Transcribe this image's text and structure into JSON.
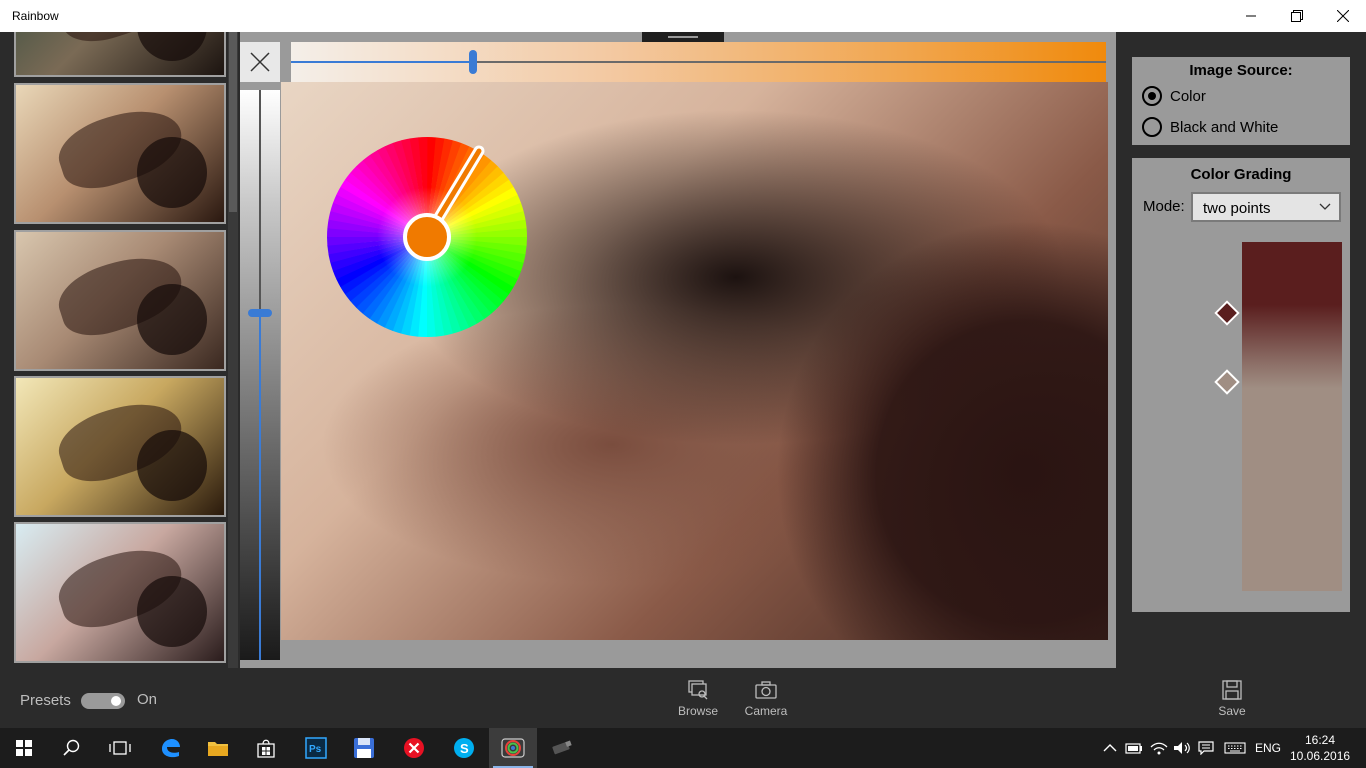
{
  "window": {
    "title": "Rainbow"
  },
  "presets": {
    "thumbnails": [
      {
        "tint": "linear-gradient(135deg,#2f4a3c,#7a6a55 50%,#1c1410)"
      },
      {
        "tint": "linear-gradient(135deg,#e9d7b8,#b89070 45%,#2a1810)"
      },
      {
        "tint": "linear-gradient(135deg,#d8c6ae,#a88a74 45%,#3a2820)"
      },
      {
        "tint": "linear-gradient(135deg,#f2e7b8,#c8a860 45%,#2a1a0c)"
      },
      {
        "tint": "linear-gradient(135deg,#d8ecf2,#c8a8a0 45%,#2a1c1c)"
      }
    ]
  },
  "editor": {
    "close_label": "Close",
    "vertical_slider_value": 0.37,
    "horizontal_slider_value": 0.223,
    "photo_description": "Photo"
  },
  "image_source": {
    "title": "Image Source:",
    "options": [
      {
        "label": "Color",
        "checked": true
      },
      {
        "label": "Black and White",
        "checked": false
      }
    ]
  },
  "color_grading": {
    "title": "Color Grading",
    "mode_label": "Mode:",
    "mode_value": "two points",
    "point_colors": [
      "#5a1e1e",
      "#a08e83"
    ]
  },
  "appbar": {
    "presets_label": "Presets",
    "presets_state": "On",
    "browse_label": "Browse",
    "camera_label": "Camera",
    "save_label": "Save"
  },
  "taskbar": {
    "language": "ENG",
    "time": "16:24",
    "date": "10.06.2016"
  }
}
